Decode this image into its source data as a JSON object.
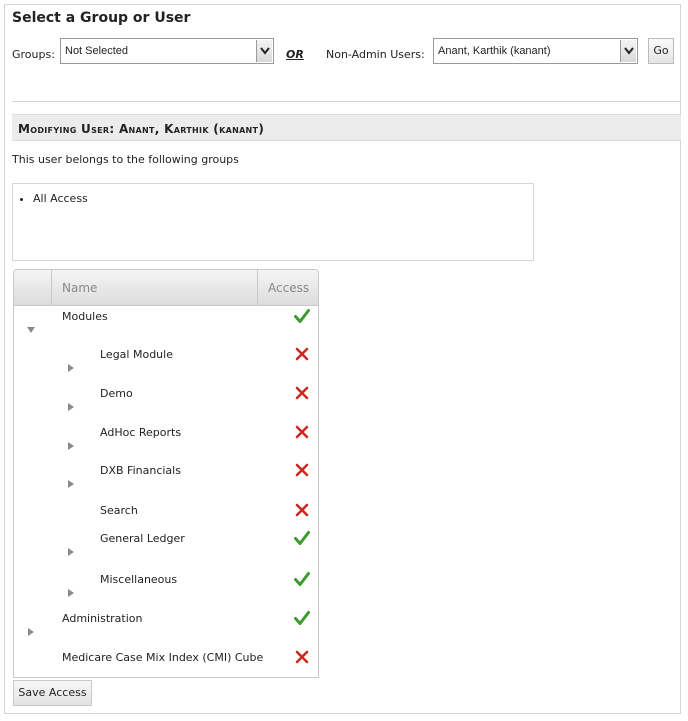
{
  "header": {
    "title": "Select a Group or User"
  },
  "filters": {
    "groups_label": "Groups:",
    "groups_value": "Not Selected",
    "or_label": "OR",
    "users_label": "Non-Admin Users:",
    "users_value": "Anant, Karthik (kanant)",
    "go_label": "Go"
  },
  "section": {
    "title": "Modifying User: Anant, Karthik (kanant)",
    "belongs_text": "This user belongs to the following groups",
    "groups": [
      "All Access"
    ]
  },
  "tree": {
    "col_name": "Name",
    "col_access": "Access",
    "rows": [
      {
        "label": "Modules",
        "level": 0,
        "toggle": "expanded",
        "access": "check"
      },
      {
        "label": "Legal Module",
        "level": 1,
        "toggle": "collapsed",
        "access": "x"
      },
      {
        "label": "Demo",
        "level": 1,
        "toggle": "collapsed",
        "access": "x"
      },
      {
        "label": "AdHoc Reports",
        "level": 1,
        "toggle": "collapsed",
        "access": "x"
      },
      {
        "label": "DXB Financials",
        "level": 1,
        "toggle": "collapsed",
        "access": "x"
      },
      {
        "label": "Search",
        "level": 1,
        "toggle": "none",
        "access": "x"
      },
      {
        "label": "General Ledger",
        "level": 1,
        "toggle": "collapsed",
        "access": "check"
      },
      {
        "label": "Miscellaneous",
        "level": 1,
        "toggle": "collapsed",
        "access": "check"
      },
      {
        "label": "Administration",
        "level": 0,
        "toggle": "collapsed",
        "access": "check"
      },
      {
        "label": "Medicare Case Mix Index (CMI) Cube",
        "level": 0,
        "toggle": "none",
        "access": "x"
      }
    ]
  },
  "actions": {
    "save_label": "Save Access"
  },
  "icons": {
    "check": "check-icon",
    "x": "x-icon",
    "expanded": "triangle-down-icon",
    "collapsed": "triangle-right-icon"
  },
  "colors": {
    "check": "#3c9a2e",
    "x": "#cc2b22",
    "toggle": "#8a8a8a",
    "header_bg": "#ececec"
  }
}
